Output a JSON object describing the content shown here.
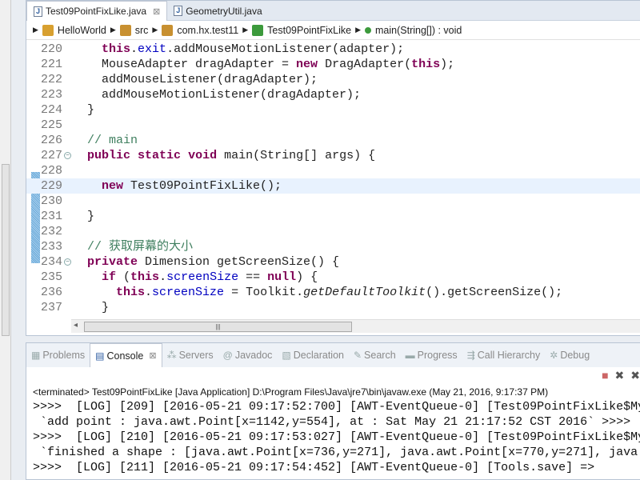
{
  "editor": {
    "tabs": [
      {
        "label": "Test09PointFixLike.java",
        "active": true,
        "close": "⊠"
      },
      {
        "label": "GeometryUtil.java",
        "active": false
      }
    ],
    "breadcrumb": [
      {
        "label": "HelloWorld",
        "icon": "project-icon",
        "color": "#d8a030"
      },
      {
        "label": "src",
        "icon": "source-folder-icon",
        "color": "#c89030"
      },
      {
        "label": "com.hx.test11",
        "icon": "package-icon",
        "color": "#c89030"
      },
      {
        "label": "Test09PointFixLike",
        "icon": "class-icon",
        "color": "#3c9a3c"
      },
      {
        "label": "main(String[]) : void",
        "icon": "method-icon",
        "color": "#3c9a3c"
      }
    ],
    "current_line": 229,
    "changed_lines": [
      226,
      231
    ],
    "lines": [
      {
        "n": "220",
        "tokens": [
          [
            "  ",
            ""
          ],
          [
            "this",
            "kw"
          ],
          [
            ".",
            ""
          ],
          [
            "exit",
            "fld"
          ],
          [
            ".addMouseMotionListener(adapter);",
            ""
          ]
        ]
      },
      {
        "n": "221",
        "tokens": [
          [
            "  MouseAdapter dragAdapter = ",
            ""
          ],
          [
            "new",
            "kw"
          ],
          [
            " DragAdapter(",
            ""
          ],
          [
            "this",
            "kw"
          ],
          [
            ");",
            ""
          ]
        ]
      },
      {
        "n": "222",
        "tokens": [
          [
            "  addMouseListener(dragAdapter);",
            ""
          ]
        ]
      },
      {
        "n": "223",
        "tokens": [
          [
            "  addMouseMotionListener(dragAdapter);",
            ""
          ]
        ]
      },
      {
        "n": "224",
        "tokens": [
          [
            "}",
            ""
          ]
        ]
      },
      {
        "n": "225",
        "tokens": []
      },
      {
        "n": "226",
        "tokens": [
          [
            "// main",
            "cm"
          ]
        ]
      },
      {
        "n": "227",
        "fold": true,
        "tokens": [
          [
            "public",
            "kw"
          ],
          [
            " ",
            ""
          ],
          [
            "static",
            "kw"
          ],
          [
            " ",
            ""
          ],
          [
            "void",
            "kw"
          ],
          [
            " main(String[] args) {",
            ""
          ]
        ]
      },
      {
        "n": "228",
        "tokens": []
      },
      {
        "n": "229",
        "tokens": [
          [
            "  ",
            ""
          ],
          [
            "new",
            "kw"
          ],
          [
            " Test09PointFixLike();",
            ""
          ]
        ]
      },
      {
        "n": "230",
        "tokens": []
      },
      {
        "n": "231",
        "tokens": [
          [
            "}",
            ""
          ]
        ]
      },
      {
        "n": "232",
        "tokens": []
      },
      {
        "n": "233",
        "tokens": [
          [
            "// 获取屏幕的大小",
            "cm"
          ]
        ]
      },
      {
        "n": "234",
        "fold": true,
        "tokens": [
          [
            "private",
            "kw"
          ],
          [
            " Dimension getScreenSize() {",
            ""
          ]
        ]
      },
      {
        "n": "235",
        "tokens": [
          [
            "  ",
            ""
          ],
          [
            "if",
            "kw"
          ],
          [
            " (",
            ""
          ],
          [
            "this",
            "kw"
          ],
          [
            ".",
            ""
          ],
          [
            "screenSize",
            "fld"
          ],
          [
            " == ",
            ""
          ],
          [
            "null",
            "kw"
          ],
          [
            ") {",
            ""
          ]
        ]
      },
      {
        "n": "236",
        "tokens": [
          [
            "    ",
            ""
          ],
          [
            "this",
            "kw"
          ],
          [
            ".",
            ""
          ],
          [
            "screenSize",
            "fld"
          ],
          [
            " = Toolkit.",
            ""
          ],
          [
            "getDefaultToolkit",
            "it"
          ],
          [
            "().getScreenSize();",
            ""
          ]
        ]
      },
      {
        "n": "237",
        "tokens": [
          [
            "  }",
            ""
          ]
        ]
      }
    ]
  },
  "console": {
    "tabs": [
      {
        "label": "Problems",
        "icon": "problems-icon"
      },
      {
        "label": "Console",
        "icon": "console-icon",
        "active": true
      },
      {
        "label": "Servers",
        "icon": "servers-icon"
      },
      {
        "label": "Javadoc",
        "icon": "at-icon"
      },
      {
        "label": "Declaration",
        "icon": "declaration-icon"
      },
      {
        "label": "Search",
        "icon": "search-icon"
      },
      {
        "label": "Progress",
        "icon": "progress-icon"
      },
      {
        "label": "Call Hierarchy",
        "icon": "call-hierarchy-icon"
      },
      {
        "label": "Debug",
        "icon": "debug-icon"
      }
    ],
    "close": "⊠",
    "terminated": "<terminated> Test09PointFixLike [Java Application] D:\\Program Files\\Java\\jre7\\bin\\javaw.exe (May 21, 2016, 9:17:37 PM)",
    "output": [
      ">>>>  [LOG] [209] [2016-05-21 09:17:52:700] [AWT-EventQueue-0] [Test09PointFixLike$My",
      " `add point : java.awt.Point[x=1142,y=554], at : Sat May 21 21:17:52 CST 2016` >>>>",
      ">>>>  [LOG] [210] [2016-05-21 09:17:53:027] [AWT-EventQueue-0] [Test09PointFixLike$My",
      " `finished a shape : [java.awt.Point[x=736,y=271], java.awt.Point[x=770,y=271], java",
      ">>>>  [LOG] [211] [2016-05-21 09:17:54:452] [AWT-EventQueue-0] [Tools.save] =>"
    ]
  }
}
